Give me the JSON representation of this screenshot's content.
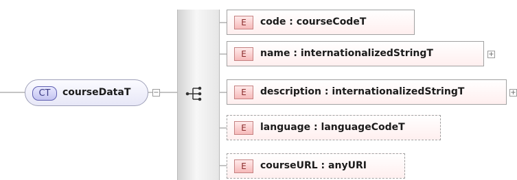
{
  "complex_type": {
    "badge": "CT",
    "name": "courseDataT",
    "toggle_symbol": "−"
  },
  "elements": [
    {
      "badge": "E",
      "name": "code",
      "separator": " : ",
      "type": "courseCodeT",
      "expandable": false,
      "optional": false
    },
    {
      "badge": "E",
      "name": "name",
      "separator": " : ",
      "type": "internationalizedStringT",
      "expandable": true,
      "optional": false
    },
    {
      "badge": "E",
      "name": "description",
      "separator": " : ",
      "type": "internationalizedStringT",
      "expandable": true,
      "optional": false
    },
    {
      "badge": "E",
      "name": "language",
      "separator": " : ",
      "type": "languageCodeT",
      "expandable": false,
      "optional": true
    },
    {
      "badge": "E",
      "name": "courseURL",
      "separator": " : ",
      "type": "anyURI",
      "expandable": false,
      "optional": true
    }
  ],
  "expand_symbol": "+",
  "colors": {
    "ct_badge": "#c3c3f0",
    "element_badge": "#f6b9b9",
    "connector": "#8a8a8a"
  }
}
